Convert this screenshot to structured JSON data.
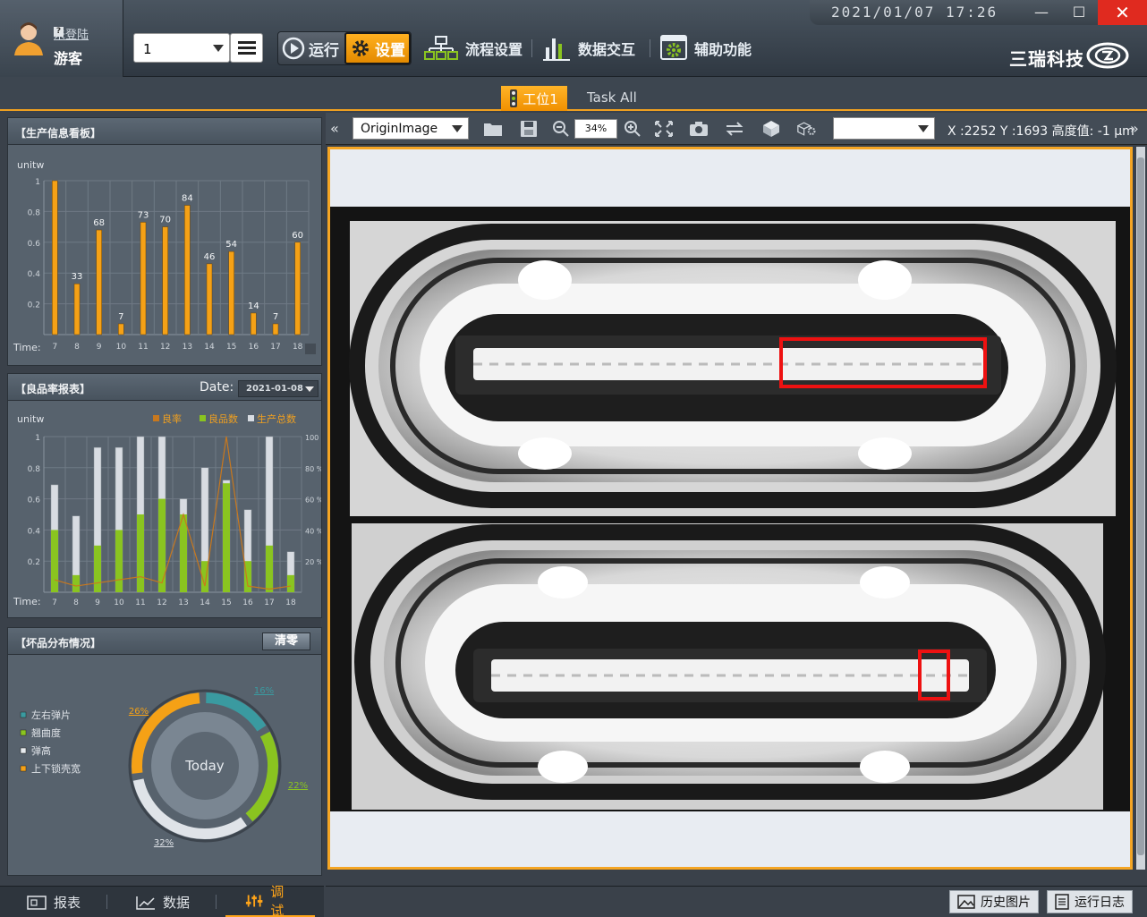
{
  "user": {
    "login_link": "未登陆",
    "name": "游客"
  },
  "toolbar": {
    "station_value": "1",
    "run_label": "运行",
    "settings_label": "设置",
    "nav": [
      {
        "label": "流程设置",
        "icon": "flowchart-icon"
      },
      {
        "label": "数据交互",
        "icon": "bar-chart-icon"
      },
      {
        "label": "辅助功能",
        "icon": "gear-screen-icon"
      }
    ]
  },
  "clock": "2021/01/07  17:26",
  "brand": "三瑞科技",
  "tabs": {
    "station": "工位1",
    "task": "Task All"
  },
  "panel1": {
    "title": "【生产信息看板】",
    "unit": "unitw",
    "time_label": "Time:"
  },
  "panel2": {
    "title": "【良品率报表】",
    "date_label": "Date:",
    "date_value": "2021-01-08",
    "unit": "unitw",
    "legend": [
      "良率",
      "良品数",
      "生产总数"
    ],
    "time_label": "Time:"
  },
  "panel3": {
    "title": "【坏品分布情况】",
    "clear_button": "清零",
    "center_label": "Today",
    "legend": [
      {
        "label": "左右弹片",
        "color": "#3a9aa0"
      },
      {
        "label": "翘曲度",
        "color": "#8ac420"
      },
      {
        "label": "弹高",
        "color": "#e8ecf0"
      },
      {
        "label": "上下锁壳宽",
        "color": "#f5a116"
      }
    ]
  },
  "chart_data": [
    {
      "type": "bar",
      "title": "【生产信息看板】",
      "ylabel": "unitw",
      "xlabel": "Time:",
      "categories": [
        "7",
        "8",
        "9",
        "10",
        "11",
        "12",
        "13",
        "14",
        "15",
        "16",
        "17",
        "18"
      ],
      "values": [
        1.0,
        0.33,
        0.68,
        0.07,
        0.73,
        0.7,
        0.84,
        0.46,
        0.54,
        0.14,
        0.07,
        0.6
      ],
      "data_labels": [
        "",
        "33",
        "68",
        "7",
        "73",
        "70",
        "84",
        "46",
        "54",
        "14",
        "7",
        "60"
      ],
      "yticks": [
        "0.2",
        "0.4",
        "0.6",
        "0.8",
        "1"
      ],
      "ylim": [
        0,
        1
      ],
      "color": "#f5a116"
    },
    {
      "type": "bar",
      "title": "【良品率报表】",
      "ylabel": "unitw",
      "xlabel": "Time:",
      "categories": [
        "7",
        "8",
        "9",
        "10",
        "11",
        "12",
        "13",
        "14",
        "15",
        "16",
        "17",
        "18"
      ],
      "series": [
        {
          "name": "生产总数",
          "values": [
            0.69,
            0.49,
            0.93,
            0.93,
            1.0,
            1.0,
            0.6,
            0.8,
            0.72,
            0.53,
            1.0,
            0.26
          ]
        },
        {
          "name": "良品数",
          "values": [
            0.4,
            0.11,
            0.3,
            0.4,
            0.5,
            0.6,
            0.5,
            0.2,
            0.7,
            0.2,
            0.3,
            0.11
          ]
        },
        {
          "name": "良率",
          "values": [
            0.08,
            0.04,
            0.06,
            0.08,
            0.1,
            0.06,
            0.5,
            0.04,
            1.0,
            0.04,
            0.02,
            0.04
          ]
        }
      ],
      "yticks": [
        "0.2",
        "0.4",
        "0.6",
        "0.8",
        "1"
      ],
      "y2ticks": [
        "20 %",
        "40 %",
        "60 %",
        "80 %",
        "100 %"
      ],
      "ylim": [
        0,
        1
      ],
      "colors": {
        "良率": "#c8781e",
        "良品数": "#8ac420",
        "生产总数": "#d8dce2"
      }
    },
    {
      "type": "pie",
      "title": "【坏品分布情况】",
      "categories": [
        "左右弹片",
        "翘曲度",
        "弹高",
        "上下锁壳宽"
      ],
      "values": [
        16,
        22,
        32,
        26
      ],
      "data_labels": [
        "16%",
        "22%",
        "32%",
        "26%"
      ],
      "colors": [
        "#3a9aa0",
        "#8ac420",
        "#dfe3e8",
        "#f5a116"
      ]
    }
  ],
  "bottom_nav": [
    {
      "label": "报表",
      "icon": "report-icon"
    },
    {
      "label": "数据",
      "icon": "line-chart-icon"
    },
    {
      "label": "调试",
      "icon": "sliders-icon"
    }
  ],
  "viewer": {
    "image_select": "OriginImage",
    "zoom": "34%",
    "coord_readout": "X :2252 Y :1693 高度值: -1 μm"
  },
  "status": {
    "history_button": "历史图片",
    "log_button": "运行日志"
  }
}
